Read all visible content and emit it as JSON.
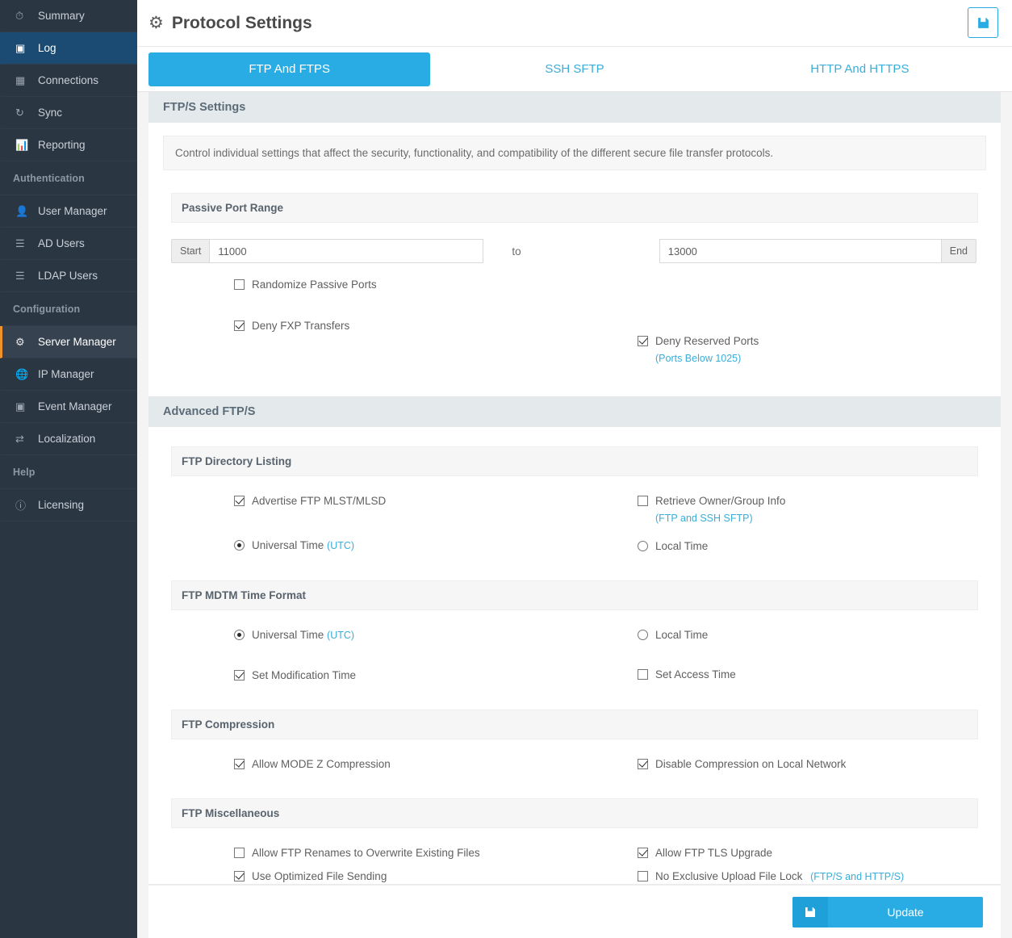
{
  "sidebar": {
    "groups": [
      {
        "heading": null,
        "items": [
          {
            "label": "Summary",
            "icon": "clock-icon",
            "state": "normal"
          },
          {
            "label": "Log",
            "icon": "log-book-icon",
            "state": "active-blue"
          },
          {
            "label": "Connections",
            "icon": "grid-icon",
            "state": "normal"
          },
          {
            "label": "Sync",
            "icon": "refresh-icon",
            "state": "normal"
          },
          {
            "label": "Reporting",
            "icon": "bar-chart-icon",
            "state": "normal"
          }
        ]
      },
      {
        "heading": "Authentication",
        "items": [
          {
            "label": "User Manager",
            "icon": "user-icon",
            "state": "normal"
          },
          {
            "label": "AD Users",
            "icon": "list-icon",
            "state": "normal"
          },
          {
            "label": "LDAP Users",
            "icon": "list-icon",
            "state": "normal"
          }
        ]
      },
      {
        "heading": "Configuration",
        "items": [
          {
            "label": "Server Manager",
            "icon": "gear-icon",
            "state": "active-orange"
          },
          {
            "label": "IP Manager",
            "icon": "globe-icon",
            "state": "normal"
          },
          {
            "label": "Event Manager",
            "icon": "clipboard-icon",
            "state": "normal"
          },
          {
            "label": "Localization",
            "icon": "exchange-icon",
            "state": "normal"
          }
        ]
      },
      {
        "heading": "Help",
        "items": [
          {
            "label": "Licensing",
            "icon": "info-icon",
            "state": "normal"
          }
        ]
      }
    ]
  },
  "header": {
    "icon": "gear-icon",
    "title": "Protocol Settings",
    "save_icon": "floppy-save-icon"
  },
  "tabs": [
    {
      "label": "FTP And FTPS",
      "active": true
    },
    {
      "label": "SSH SFTP",
      "active": false
    },
    {
      "label": "HTTP And HTTPS",
      "active": false
    }
  ],
  "panels": {
    "ftps_settings": {
      "title": "FTP/S Settings",
      "description": "Control individual settings that affect the security, functionality, and compatibility of the different secure file transfer protocols."
    },
    "passive_port_range": {
      "title": "Passive Port Range",
      "start_addon": "Start",
      "start_value": "11000",
      "to_label": "to",
      "end_value": "13000",
      "end_addon": "End",
      "options_left": [
        {
          "type": "checkbox",
          "label": "Randomize Passive Ports",
          "checked": false
        },
        {
          "type": "checkbox",
          "label": "Deny FXP Transfers",
          "checked": true
        }
      ],
      "options_right": [
        {
          "type": "checkbox",
          "label": "Deny Reserved Ports",
          "checked": true,
          "hint": "(Ports Below 1025)"
        }
      ]
    },
    "advanced_ftps": {
      "title": "Advanced FTP/S"
    },
    "ftp_directory_listing": {
      "title": "FTP Directory Listing",
      "options_left": [
        {
          "type": "checkbox",
          "label": "Advertise FTP MLST/MLSD",
          "checked": true
        },
        {
          "type": "radio",
          "label": "Universal Time",
          "hint": "(UTC)",
          "checked": true
        }
      ],
      "options_right": [
        {
          "type": "checkbox",
          "label": "Retrieve Owner/Group Info",
          "checked": false,
          "hint": "(FTP and SSH SFTP)"
        },
        {
          "type": "radio",
          "label": "Local Time",
          "checked": false
        }
      ]
    },
    "ftp_mdtm_time_format": {
      "title": "FTP MDTM Time Format",
      "options_left": [
        {
          "type": "radio",
          "label": "Universal Time",
          "hint": "(UTC)",
          "checked": true
        },
        {
          "type": "checkbox",
          "label": "Set Modification Time",
          "checked": true
        }
      ],
      "options_right": [
        {
          "type": "radio",
          "label": "Local Time",
          "checked": false
        },
        {
          "type": "checkbox",
          "label": "Set Access Time",
          "checked": false
        }
      ]
    },
    "ftp_compression": {
      "title": "FTP Compression",
      "options_left": [
        {
          "type": "checkbox",
          "label": "Allow MODE Z Compression",
          "checked": true
        }
      ],
      "options_right": [
        {
          "type": "checkbox",
          "label": "Disable Compression on Local Network",
          "checked": true
        }
      ]
    },
    "ftp_miscellaneous": {
      "title": "FTP Miscellaneous",
      "options_left": [
        {
          "type": "checkbox",
          "label": "Allow FTP Renames to Overwrite Existing Files",
          "checked": false
        },
        {
          "type": "checkbox",
          "label": "Use Optimized File Sending",
          "checked": true
        }
      ],
      "options_right": [
        {
          "type": "checkbox",
          "label": "Allow FTP TLS Upgrade",
          "checked": true
        },
        {
          "type": "checkbox",
          "label": "No Exclusive Upload File Lock",
          "checked": false,
          "hint_inline": "(FTP/S and HTTP/S)"
        }
      ]
    }
  },
  "footer": {
    "update_label": "Update",
    "update_icon": "floppy-save-icon"
  },
  "colors": {
    "accent": "#29ace3",
    "sidebar_bg": "#2b3643",
    "sidebar_active_blue": "#1b4b72",
    "sidebar_active_orange_border": "#f0932b",
    "panel_head_bg": "#e4eaec",
    "link": "#3aadd9"
  }
}
